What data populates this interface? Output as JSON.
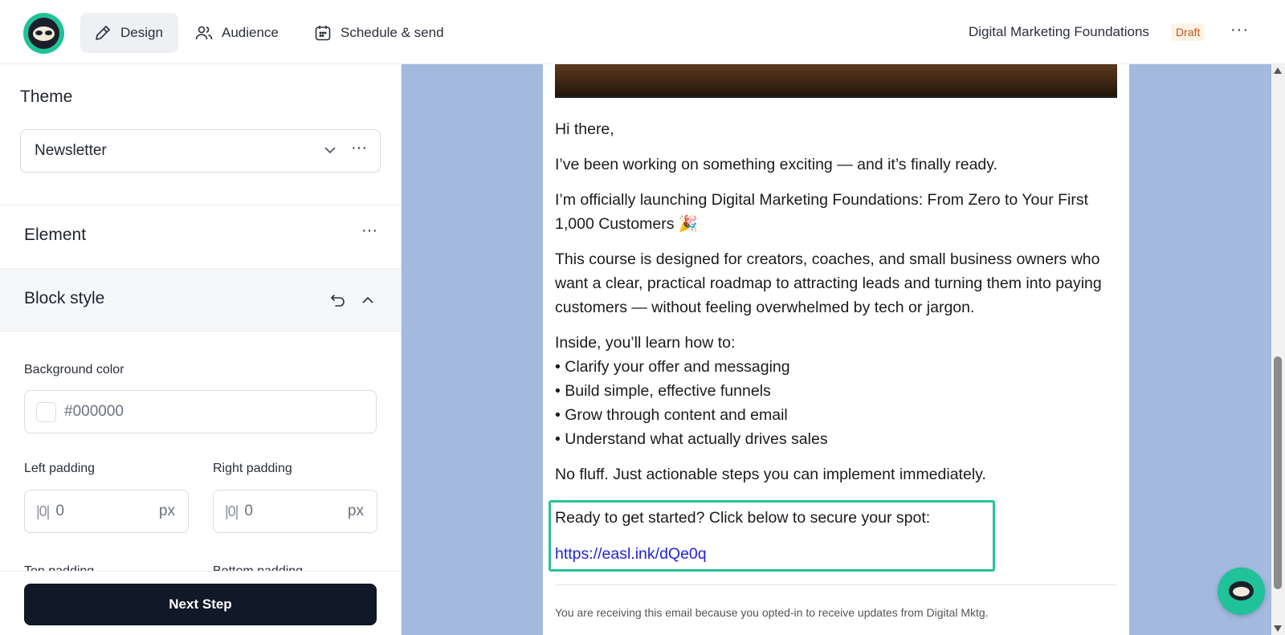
{
  "header": {
    "logo_icon": "sloth-logo-icon",
    "tabs": [
      {
        "label": "Design",
        "icon": "pen-icon",
        "active": true
      },
      {
        "label": "Audience",
        "icon": "users-icon",
        "active": false
      },
      {
        "label": "Schedule & send",
        "icon": "calendar-icon",
        "active": false
      }
    ],
    "doc_title": "Digital Marketing Foundations",
    "status_badge": "Draft",
    "more_label": "···"
  },
  "sidebar": {
    "theme": {
      "title": "Theme",
      "selected": "Newsletter",
      "more_label": "···"
    },
    "element": {
      "title": "Element",
      "more_label": "···"
    },
    "block_style": {
      "title": "Block style",
      "background_color": {
        "label": "Background color",
        "value": "#000000"
      },
      "left_padding": {
        "label": "Left padding",
        "value": "0",
        "unit": "px"
      },
      "right_padding": {
        "label": "Right padding",
        "value": "0",
        "unit": "px"
      },
      "top_padding": {
        "label": "Top padding"
      },
      "bottom_padding": {
        "label": "Bottom padding"
      }
    },
    "next_button": "Next Step"
  },
  "email": {
    "greeting": "Hi there,",
    "p1": "I’ve been working on something exciting — and it’s finally ready.",
    "p2": "I’m officially launching Digital Marketing Foundations: From Zero to Your First 1,000 Customers 🎉",
    "p3": "This course is designed for creators, coaches, and small business owners who want a clear, practical roadmap to attracting leads and turning them into paying customers — without feeling overwhelmed by tech or jargon.",
    "list_intro": "Inside, you’ll learn how to:",
    "list_items": [
      "• Clarify your offer and messaging",
      "• Build simple, effective funnels",
      "• Grow through content and email",
      "• Understand what actually drives sales"
    ],
    "p4": "No fluff. Just actionable steps you can implement immediately.",
    "cta_text": "Ready to get started? Click below to secure your spot:",
    "cta_link": "https://easl.ink/dQe0q",
    "footer": "You are receiving this email because you opted-in to receive updates from Digital Mktg."
  },
  "colors": {
    "accent": "#20c29a",
    "canvas_bg": "#a3b9de",
    "selection": "#25c29a",
    "link": "#2323d6",
    "button": "#111827",
    "draft": "#c2541f"
  }
}
